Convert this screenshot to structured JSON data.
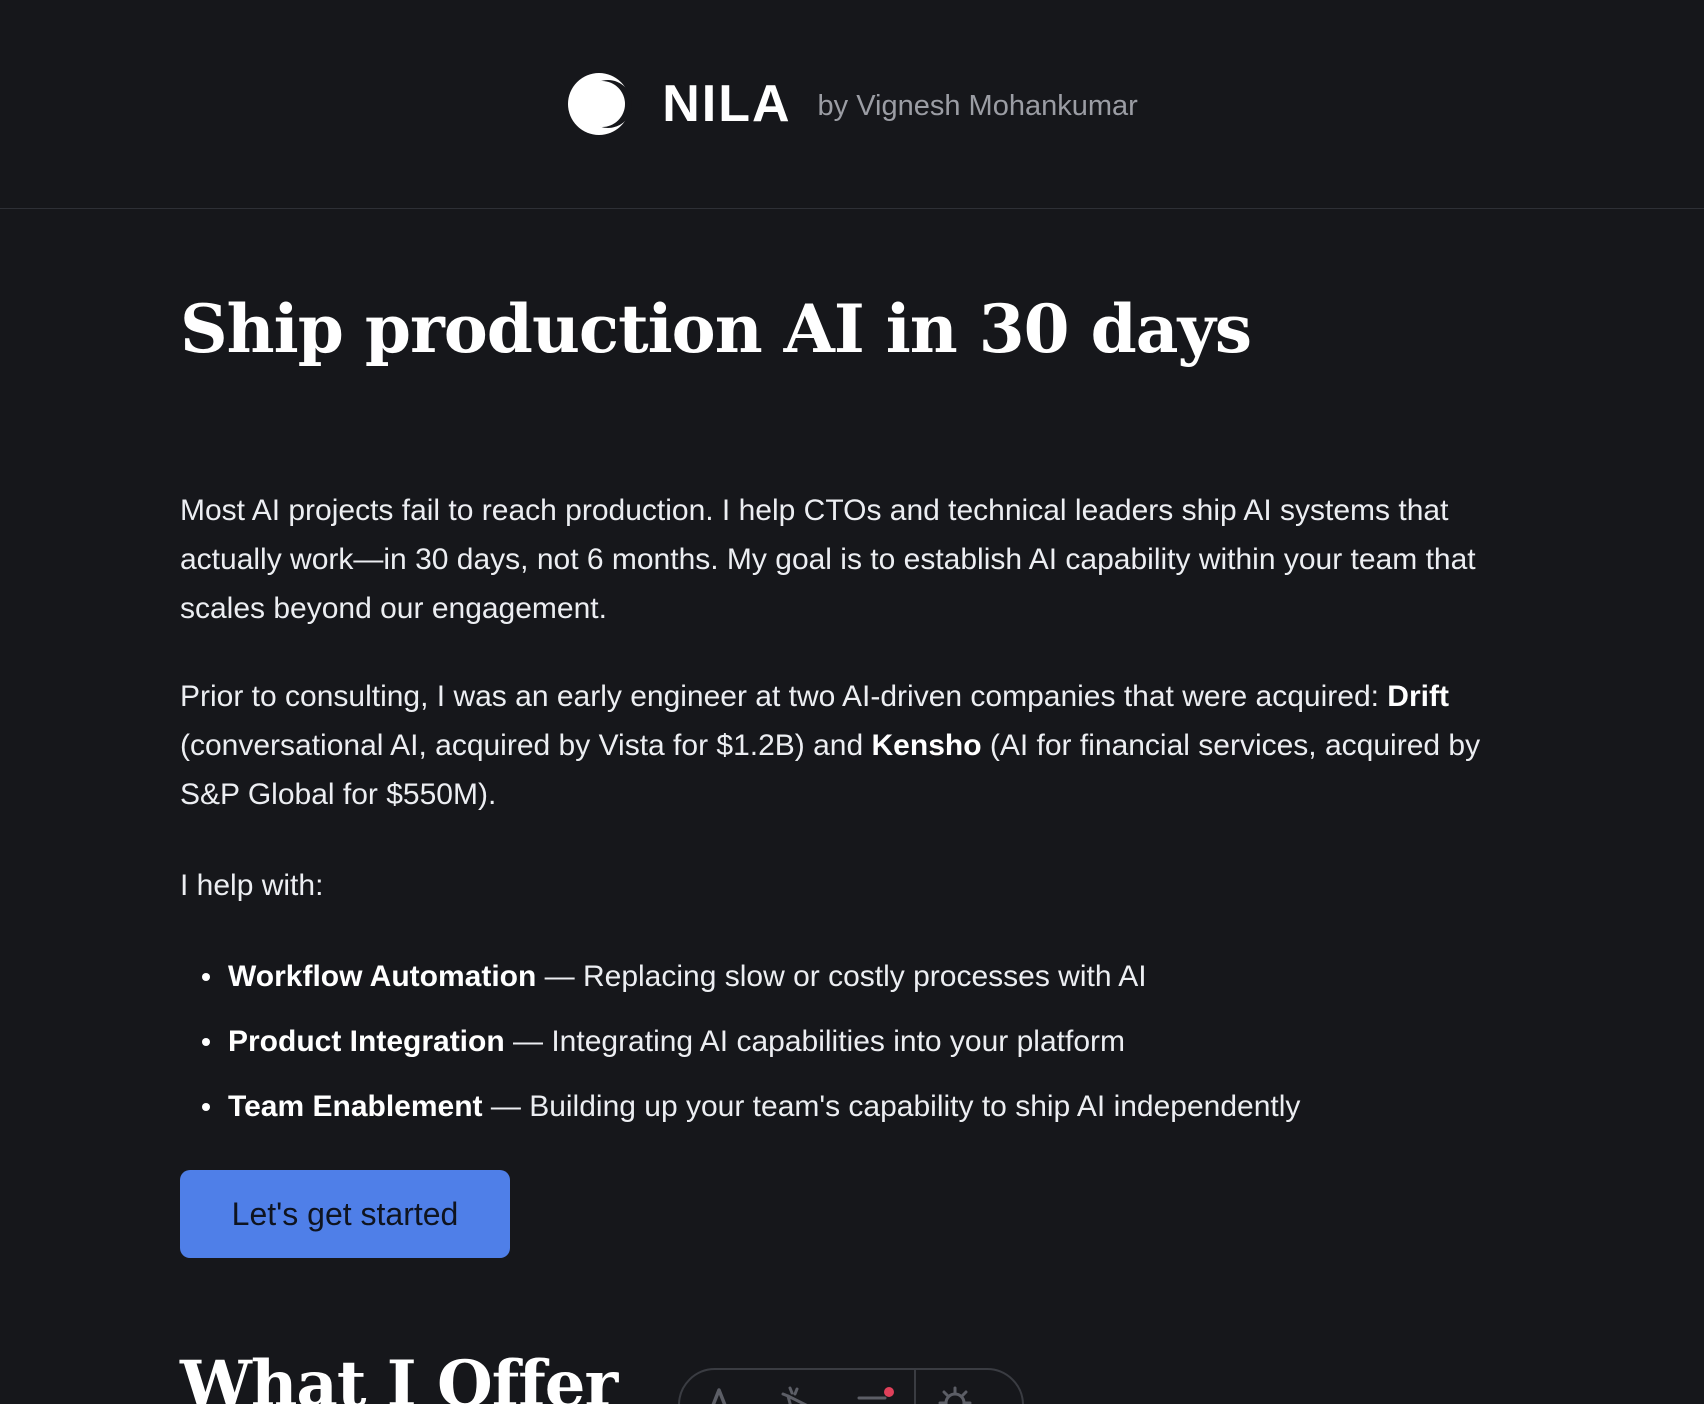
{
  "header": {
    "brand_name": "NILA",
    "byline": "by Vignesh Mohankumar",
    "logo_icon": "crescent-moon-icon"
  },
  "hero": {
    "title": "Ship production AI in 30 days"
  },
  "intro": {
    "paragraph1": "Most AI projects fail to reach production. I help CTOs and technical leaders ship AI systems that actually work—in 30 days, not 6 months. My goal is to establish AI capability within your team that scales beyond our engagement.",
    "p2_lead": "Prior to consulting, I was an early engineer at two AI-driven companies that were acquired: ",
    "p2_company1": "Drift",
    "p2_mid": " (conversational AI, acquired by Vista for $1.2B) and ",
    "p2_company2": "Kensho",
    "p2_tail": " (AI for financial services, acquired by S&P Global for $550M).",
    "help_intro": "I help with:"
  },
  "services": [
    {
      "title": "Workflow Automation",
      "desc": " — Replacing slow or costly processes with AI"
    },
    {
      "title": "Product Integration",
      "desc": " — Integrating AI capabilities into your platform"
    },
    {
      "title": "Team Enablement",
      "desc": " — Building up your team's capability to ship AI independently"
    }
  ],
  "cta": {
    "label": "Let's get started"
  },
  "offer_section": {
    "title": "What I Offer"
  },
  "toolbar": {
    "icons": [
      "font-icon",
      "pointer-icon",
      "menu-notification-icon",
      "settings-icon"
    ],
    "colors": {
      "icon": "#5c5e66",
      "badge": "#e0405a"
    }
  },
  "colors": {
    "background": "#16171b",
    "accent": "#4f7fe8",
    "text": "#eceef2",
    "muted": "#9b9da4"
  }
}
